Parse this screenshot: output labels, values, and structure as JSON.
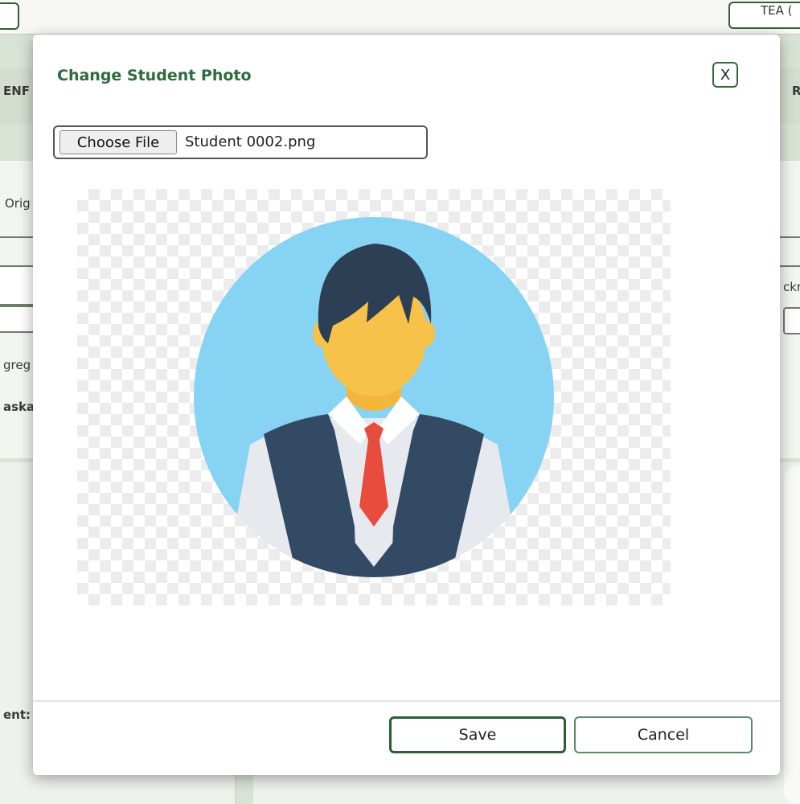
{
  "background": {
    "top_button_right": "TEA (",
    "tab_left_fragment": "ENF",
    "tab_right_fragment": "R",
    "field_label_1": "Orig",
    "field_label_2": "ckr",
    "field_label_3": "greg",
    "field_value_1": "aska",
    "field_label_4": "ent:"
  },
  "modal": {
    "title": "Change Student Photo",
    "close_label": "X",
    "file_input": {
      "button_label": "Choose File",
      "file_name": "Student 0002.png"
    },
    "photo": {
      "image_name": "student-avatar-icon",
      "colors": {
        "circle": "#87d3f4",
        "hair": "#2c3f55",
        "skin": "#f7c24a",
        "vest": "#324a63",
        "shirt": "#e6e9ee",
        "tie": "#e74c3c"
      }
    },
    "save_label": "Save",
    "cancel_label": "Cancel"
  }
}
